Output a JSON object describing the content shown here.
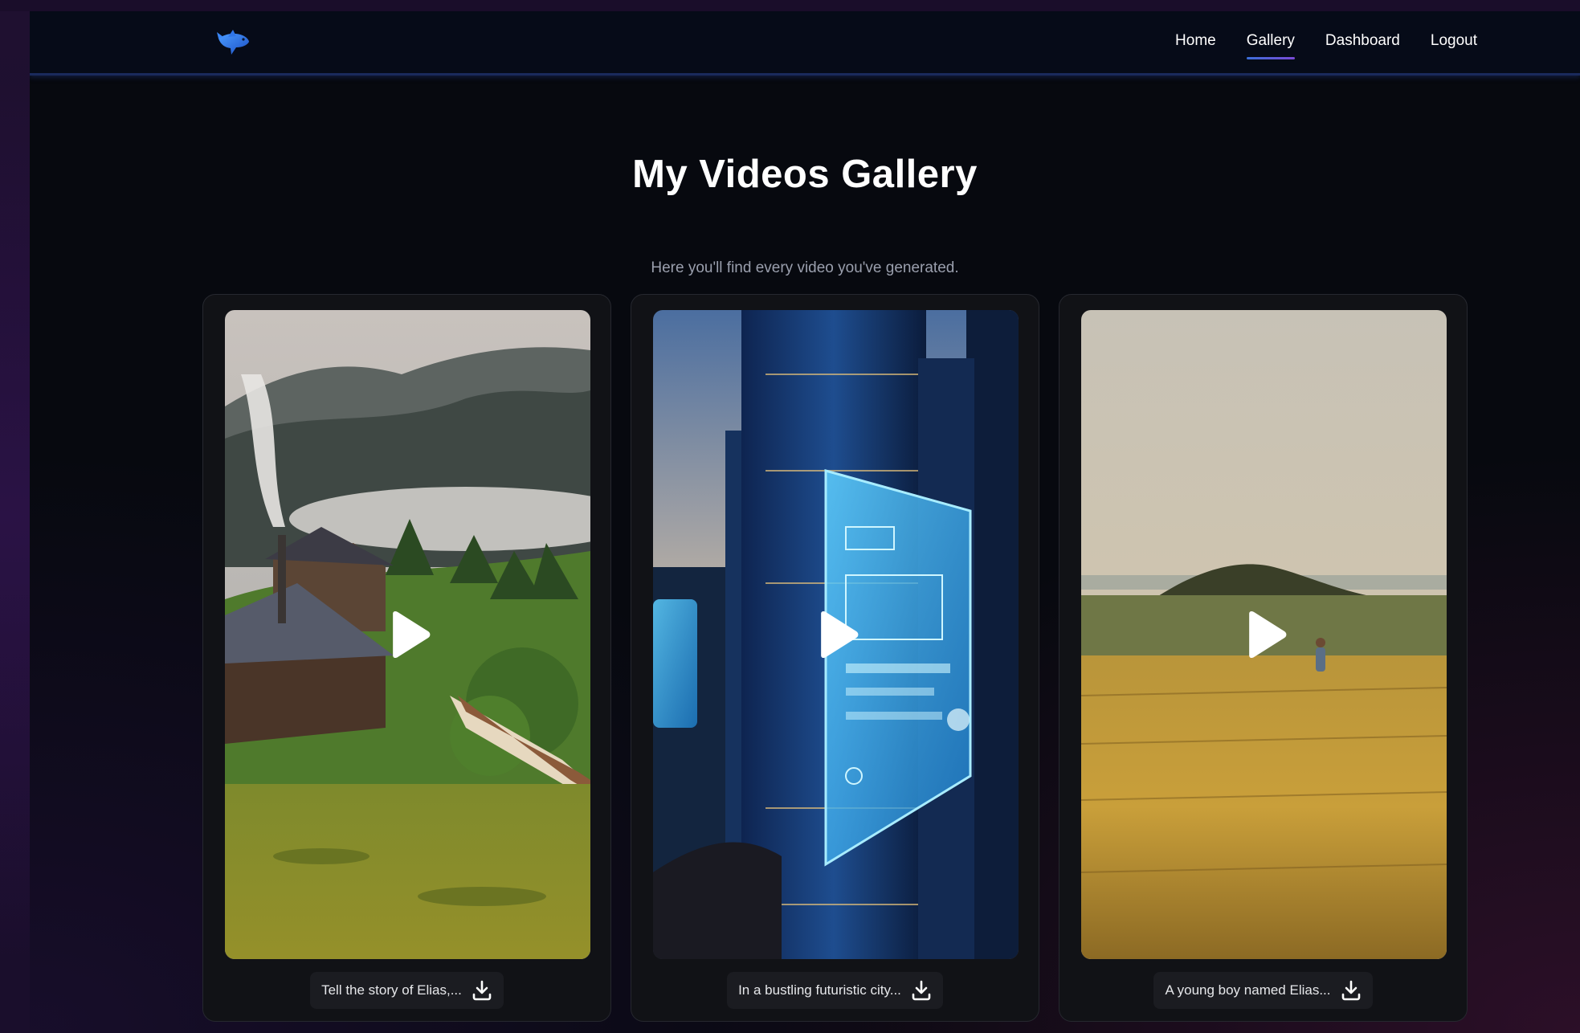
{
  "nav": {
    "links": [
      {
        "label": "Home",
        "active": false
      },
      {
        "label": "Gallery",
        "active": true
      },
      {
        "label": "Dashboard",
        "active": false
      },
      {
        "label": "Logout",
        "active": false
      }
    ]
  },
  "page": {
    "title": "My Videos Gallery",
    "subtitle": "Here you'll find every video you've generated."
  },
  "videos": [
    {
      "caption": "Tell the story of Elias,..."
    },
    {
      "caption": "In a bustling futuristic city..."
    },
    {
      "caption": "A young boy named Elias..."
    }
  ],
  "icons": {
    "logo": "fish-logo-icon",
    "play": "play-icon",
    "download": "download-icon"
  },
  "colors": {
    "accent_start": "#3b6fd9",
    "accent_end": "#7a4ad6",
    "navbar_bg": "#060b18",
    "card_bg": "#111216"
  }
}
